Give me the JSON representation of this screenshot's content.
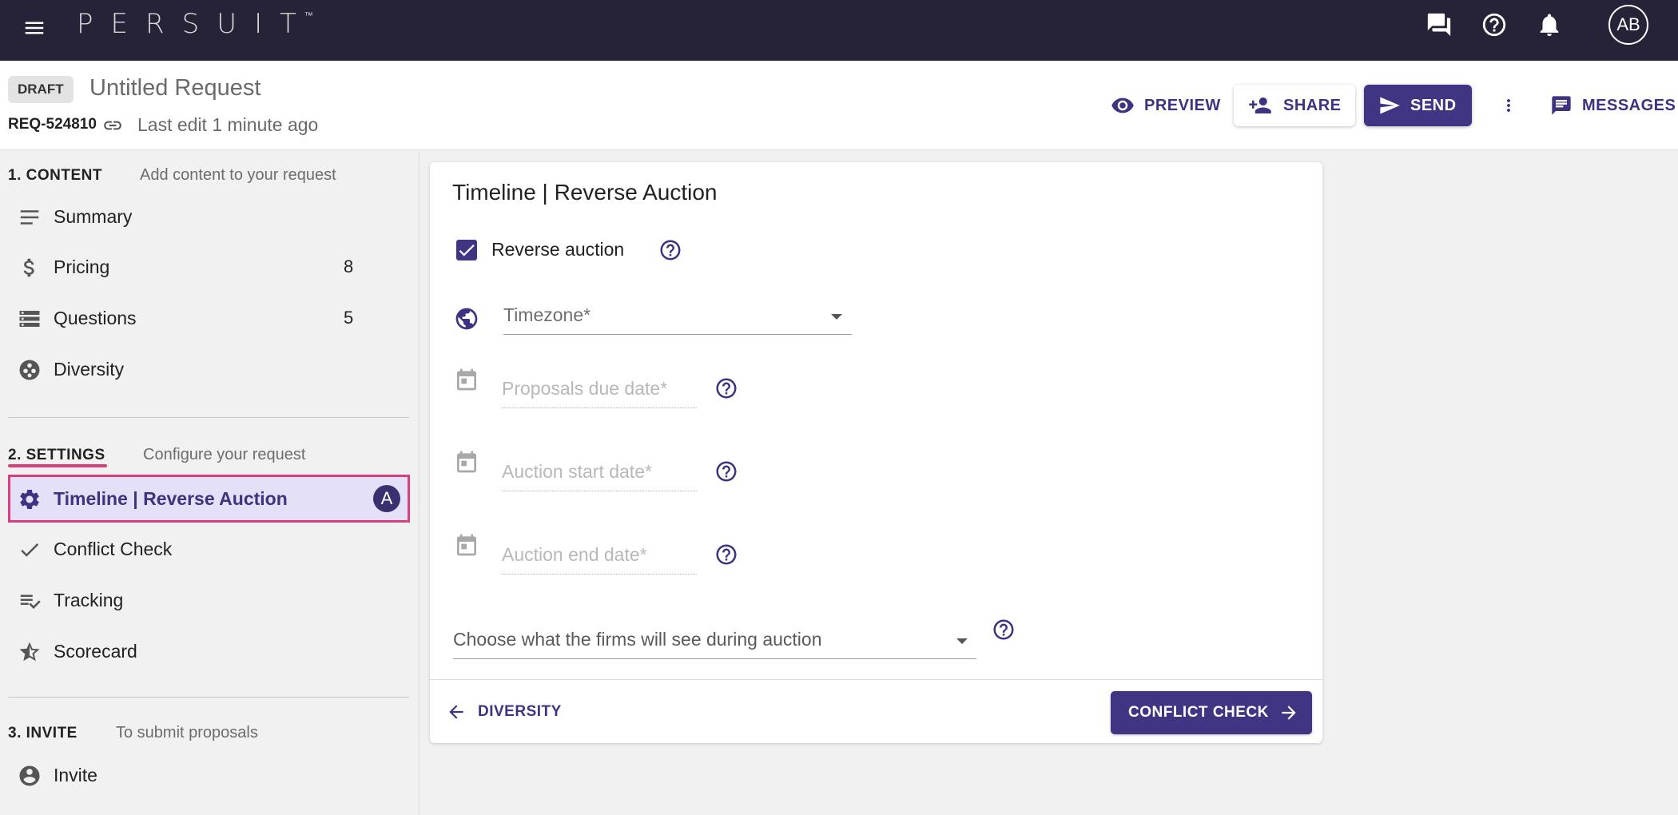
{
  "app": {
    "logo": "PERSUIT",
    "logo_tm": "™",
    "avatar_initials": "AB"
  },
  "header": {
    "status_badge": "DRAFT",
    "title": "Untitled Request",
    "request_id": "REQ-524810",
    "last_edit": "Last edit 1 minute ago",
    "preview_label": "PREVIEW",
    "share_label": "SHARE",
    "send_label": "SEND",
    "messages_label": "MESSAGES"
  },
  "sidebar": {
    "content_section": {
      "heading": "1. CONTENT",
      "description": "Add content to your request"
    },
    "content_items": [
      {
        "label": "Summary",
        "icon": "lines-icon",
        "count": ""
      },
      {
        "label": "Pricing",
        "icon": "dollar-icon",
        "count": "8"
      },
      {
        "label": "Questions",
        "icon": "storage-icon",
        "count": "5"
      },
      {
        "label": "Diversity",
        "icon": "diversity-icon",
        "count": ""
      }
    ],
    "settings_section": {
      "heading": "2. SETTINGS",
      "description": "Configure your request"
    },
    "settings_items": [
      {
        "label": "Timeline | Reverse Auction",
        "icon": "gear-icon",
        "badge": "A",
        "active": true
      },
      {
        "label": "Conflict Check",
        "icon": "check-icon"
      },
      {
        "label": "Tracking",
        "icon": "playlist-check-icon"
      },
      {
        "label": "Scorecard",
        "icon": "star-half-icon"
      }
    ],
    "invite_section": {
      "heading": "3. INVITE",
      "description": "To submit proposals"
    },
    "invite_items": [
      {
        "label": "Invite",
        "icon": "account-circle-icon"
      }
    ]
  },
  "main": {
    "title": "Timeline | Reverse Auction",
    "reverse_auction": {
      "label": "Reverse auction",
      "checked": true
    },
    "timezone": {
      "placeholder": "Timezone*"
    },
    "proposals_due": {
      "placeholder": "Proposals due date*"
    },
    "auction_start": {
      "placeholder": "Auction start date*"
    },
    "auction_end": {
      "placeholder": "Auction end date*"
    },
    "visibility_select": {
      "placeholder": "Choose what the firms will see during auction"
    },
    "back_label": "DIVERSITY",
    "next_label": "CONFLICT CHECK"
  },
  "colors": {
    "topbar": "#262338",
    "primary": "#3f3583",
    "highlight_border": "#d83f7d",
    "active_bg": "#e4e0f7"
  }
}
